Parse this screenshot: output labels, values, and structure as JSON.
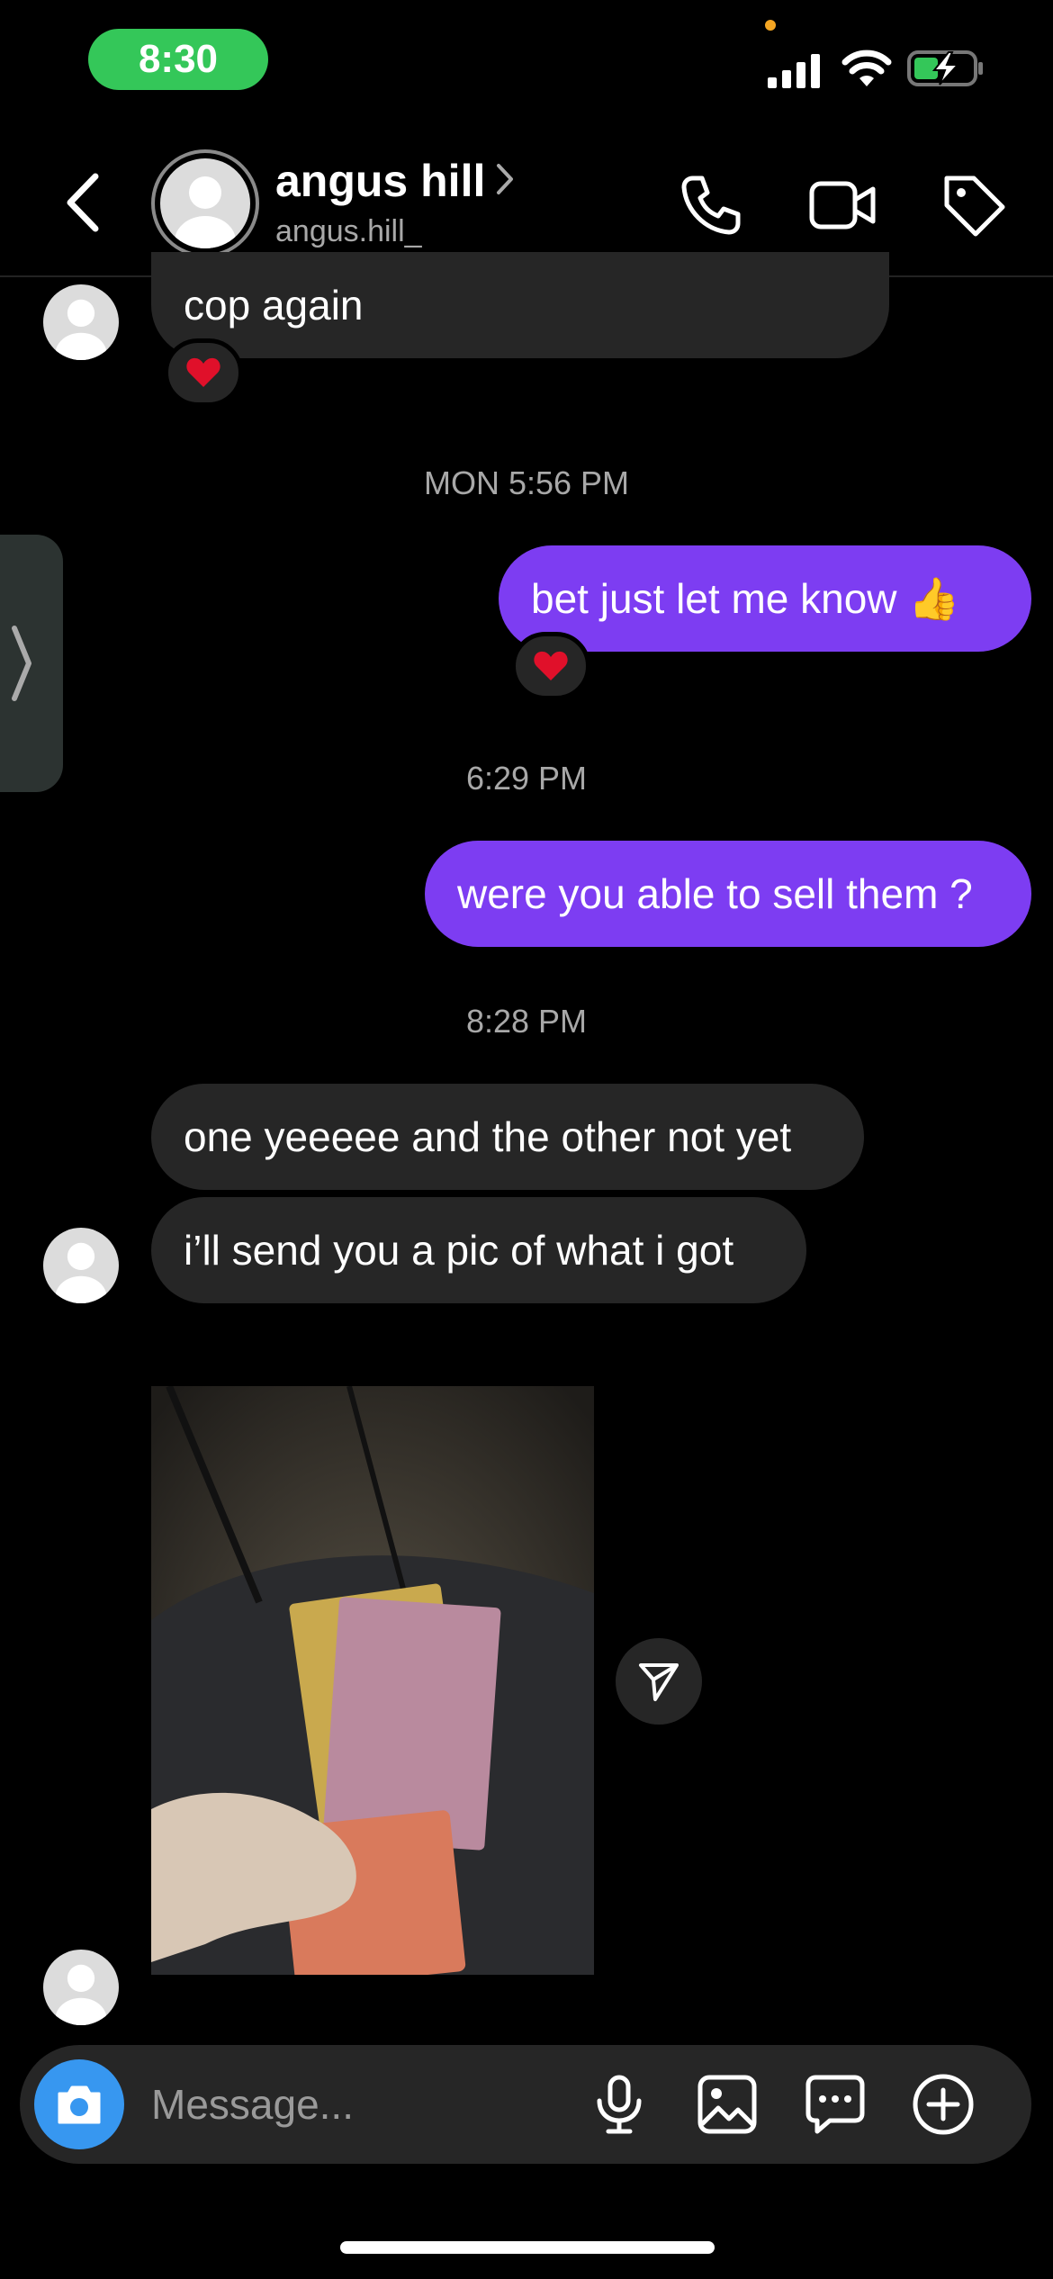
{
  "status_bar": {
    "time": "8:30"
  },
  "header": {
    "name": "angus hill",
    "username": "angus.hill_",
    "icons": [
      "back-icon",
      "chevron-right-icon",
      "phone-icon",
      "video-icon",
      "tag-icon"
    ]
  },
  "messages": [
    {
      "type": "received",
      "text": "cop again",
      "reaction": "❤️"
    },
    {
      "type": "timestamp",
      "text": "MON 5:56 PM"
    },
    {
      "type": "sent",
      "text": "bet just let me know 👍",
      "reaction": "❤️"
    },
    {
      "type": "timestamp",
      "text": "6:29 PM"
    },
    {
      "type": "sent",
      "text": "were you able to sell them ?"
    },
    {
      "type": "timestamp",
      "text": "8:28 PM"
    },
    {
      "type": "received",
      "text": "one yeeeee and the other not yet"
    },
    {
      "type": "received",
      "text": "i’ll send you a pic of what i got"
    },
    {
      "type": "received_photo",
      "description_icon": "photo-message"
    }
  ],
  "composer": {
    "placeholder": "Message...",
    "icons": [
      "camera-icon",
      "microphone-icon",
      "gallery-icon",
      "sticker-icon",
      "plus-icon"
    ]
  },
  "colors": {
    "sent_bubble": "#7d3df2",
    "received_bubble": "#262626",
    "camera_button": "#3797f0",
    "time_pill": "#34c759"
  }
}
